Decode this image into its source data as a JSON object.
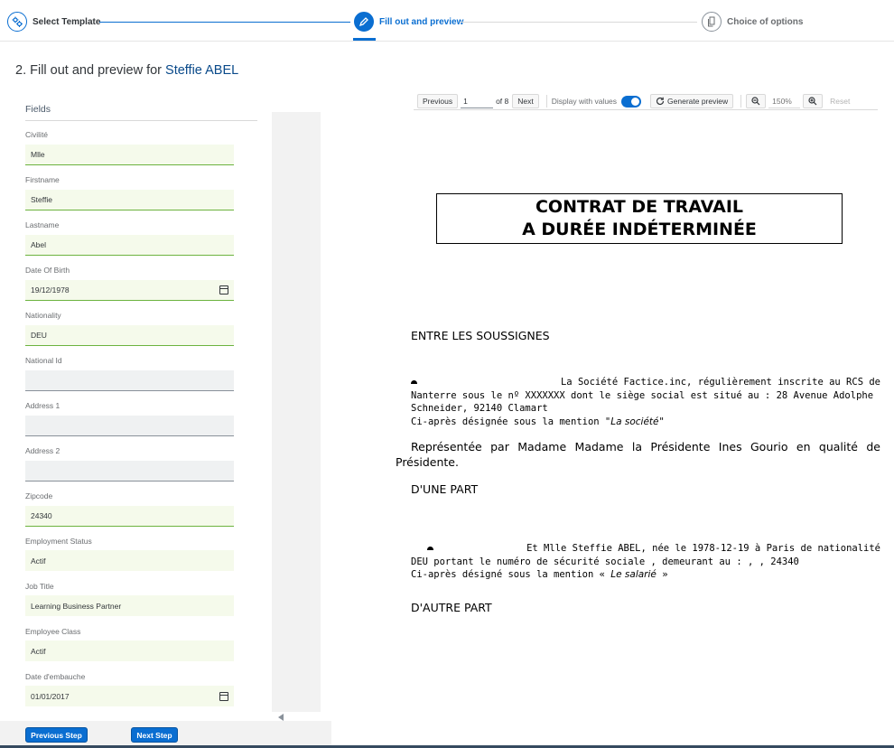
{
  "wizard": {
    "steps": [
      {
        "label": "Select Template",
        "state": "done"
      },
      {
        "label": "Fill out and preview",
        "state": "active"
      },
      {
        "label": "Choice of options",
        "state": "inactive"
      }
    ]
  },
  "page": {
    "title_prefix": "2. Fill out and preview for",
    "employee_name": "Steffie ABEL"
  },
  "fields": {
    "header": "Fields",
    "items": [
      {
        "label": "Civilité",
        "value": "Mlle"
      },
      {
        "label": "Firstname",
        "value": "Steffie"
      },
      {
        "label": "Lastname",
        "value": "Abel"
      },
      {
        "label": "Date Of Birth",
        "value": "19/12/1978"
      },
      {
        "label": "Nationality",
        "value": "DEU"
      },
      {
        "label": "National Id",
        "value": ""
      },
      {
        "label": "Address 1",
        "value": ""
      },
      {
        "label": "Address 2",
        "value": ""
      },
      {
        "label": "Zipcode",
        "value": "24340"
      },
      {
        "label": "Employment Status",
        "value": "Actif"
      },
      {
        "label": "Job Title",
        "value": "Learning Business Partner"
      },
      {
        "label": "Employee Class",
        "value": "Actif"
      },
      {
        "label": "Date d'embauche",
        "value": "01/01/2017"
      }
    ]
  },
  "footer": {
    "previous_step": "Previous Step",
    "next_step": "Next Step"
  },
  "toolbar": {
    "previous": "Previous",
    "page_value": "1",
    "of_pages": "of 8",
    "next": "Next",
    "display_values_label": "Display with values",
    "display_values_on": true,
    "generate_preview": "Generate preview",
    "zoom_placeholder": "150%",
    "reset": "Reset"
  },
  "document": {
    "title_line1": "CONTRAT DE TRAVAIL",
    "title_line2": "A DURÉE INDÉTERMINÉE",
    "between": "ENTRE LES SOUSSIGNES",
    "company_line1": "La Société Factice.inc, régulièrement  inscrite au RCS  de",
    "company_line2": "Nanterre sous le nº XXXXXXX dont le siège social est situé au : 28 Avenue Adolphe",
    "company_line3": "Schneider, 92140 Clamart",
    "company_line4_prefix": "Ci-après désignée sous la mention \"",
    "company_line4_em": "La société",
    "company_line4_suffix": "\"",
    "represented": "Représentée par Madame Madame la Présidente Ines Gourio en qualité de Présidente.",
    "party_one": "D'UNE PART",
    "employee_line1": "Et Mlle Steffie ABEL, née le 1978-12-19 à Paris de nationalité",
    "employee_line2": "DEU portant le numéro  de sécurité sociale , demeurant au : , , 24340",
    "employee_line3_prefix": "Ci-après désigné sous la mention « ",
    "employee_line3_em": "Le salarié",
    "employee_line3_suffix": " »",
    "party_two": "D'AUTRE PART"
  }
}
